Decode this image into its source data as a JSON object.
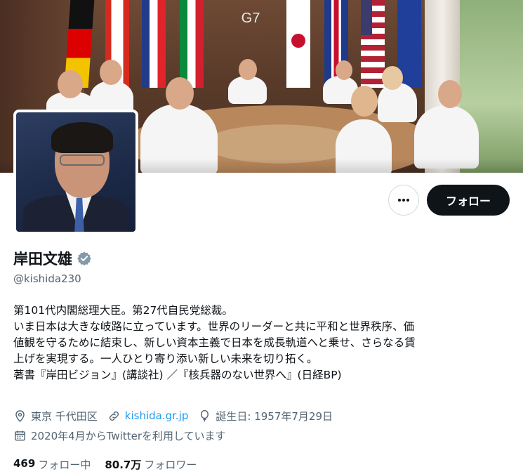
{
  "profile": {
    "name": "岸田文雄",
    "handle": "@kishida230",
    "follow_label": "フォロー",
    "bio_lines": [
      "第101代内閣総理大臣。第27代自民党総裁。",
      "いま日本は大きな岐路に立っています。世界のリーダーと共に平和と世界秩序、価",
      "値観を守るために結束し、新しい資本主義で日本を成長軌道へと乗せ、さらなる賃",
      "上げを実現する。一人ひとり寄り添い新しい未来を切り拓く。",
      "著書『岸田ビジョン』(講談社) ／『核兵器のない世界へ』(日経BP)"
    ],
    "location": "東京 千代田区",
    "website": "kishida.gr.jp",
    "birthday": "誕生日: 1957年7月29日",
    "joined": "2020年4月からTwitterを利用しています",
    "following_count": "469",
    "following_label": "フォロー中",
    "followers_count": "80.7万",
    "followers_label": "フォロワー",
    "banner_logo": "G7"
  },
  "icons": {
    "more": "more-dots-icon",
    "verified": "verified-badge-icon",
    "location": "location-pin-icon",
    "link": "link-icon",
    "birthday": "balloon-icon",
    "calendar": "calendar-icon"
  },
  "colors": {
    "accent": "#1d9bf0",
    "text": "#0f1419",
    "secondary": "#536471",
    "verified": "#829aab"
  }
}
